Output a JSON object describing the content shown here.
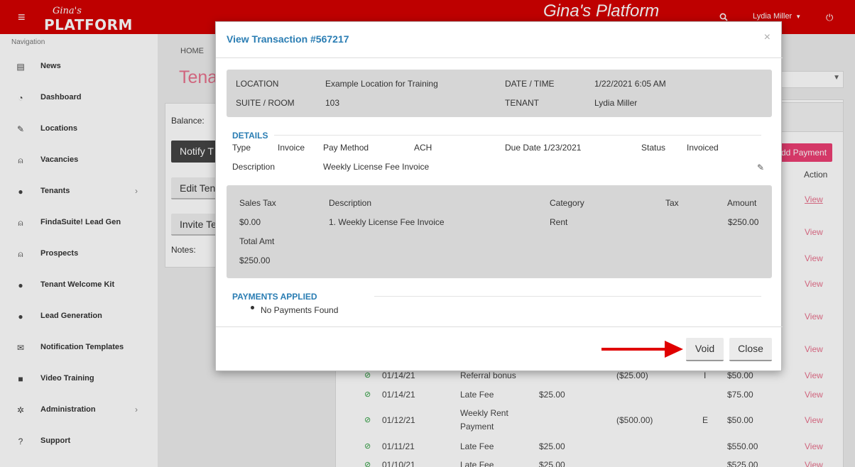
{
  "header": {
    "logo_script": "Gina's",
    "logo_main": "PLATFORM",
    "platform_name": "Gina's Platform",
    "user_name": "Lydia Miller"
  },
  "sidebar": {
    "heading": "Navigation",
    "items": [
      {
        "label": "News",
        "icon": "newspaper-icon",
        "glyph": "▤"
      },
      {
        "label": "Dashboard",
        "icon": "dashboard-icon",
        "glyph": "◔"
      },
      {
        "label": "Locations",
        "icon": "pin-icon",
        "glyph": "✎"
      },
      {
        "label": "Vacancies",
        "icon": "lock-icon",
        "glyph": "⍝"
      },
      {
        "label": "Tenants",
        "icon": "user-icon",
        "glyph": "●"
      },
      {
        "label": "FindaSuite! Lead Gen",
        "icon": "lock-icon",
        "glyph": "⍝"
      },
      {
        "label": "Prospects",
        "icon": "lock-icon",
        "glyph": "⍝"
      },
      {
        "label": "Tenant Welcome Kit",
        "icon": "user-icon",
        "glyph": "●"
      },
      {
        "label": "Lead Generation",
        "icon": "user-icon",
        "glyph": "●"
      },
      {
        "label": "Notification Templates",
        "icon": "envelope-icon",
        "glyph": "✉"
      },
      {
        "label": "Video Training",
        "icon": "video-icon",
        "glyph": "■"
      },
      {
        "label": "Administration",
        "icon": "gear-icon",
        "glyph": "✲"
      },
      {
        "label": "Support",
        "icon": "question-icon",
        "glyph": "?"
      }
    ]
  },
  "page": {
    "breadcrumb": "HOME",
    "title": "Tena",
    "balance_label": "Balance:",
    "notify_button": "Notify T",
    "edit_button": "Edit Ten",
    "invite_button": "Invite Te",
    "notes_label": "Notes:",
    "add_payment_button": "Add Payment",
    "action_header": "Action",
    "view_link": "View",
    "visible_rows": [
      {
        "date": "01/14/21",
        "description": "Referral bonus",
        "charge": "",
        "credit": "($25.00)",
        "code": "I",
        "balance": "$50.00"
      },
      {
        "date": "01/14/21",
        "description": "Late Fee",
        "charge": "$25.00",
        "credit": "",
        "code": "",
        "balance": "$75.00"
      },
      {
        "date": "01/12/21",
        "description": "Weekly Rent",
        "description2": "Payment",
        "charge": "",
        "credit": "($500.00)",
        "code": "E",
        "balance": "$50.00"
      },
      {
        "date": "01/11/21",
        "description": "Late Fee",
        "charge": "$25.00",
        "credit": "",
        "code": "",
        "balance": "$550.00"
      },
      {
        "date": "01/10/21",
        "description": "Late Fee",
        "charge": "$25.00",
        "credit": "",
        "code": "",
        "balance": "$525.00"
      }
    ]
  },
  "modal": {
    "title": "View Transaction #567217",
    "close_symbol": "×",
    "info": {
      "location_label": "LOCATION",
      "location_value": "Example Location for Training",
      "datetime_label": "DATE / TIME",
      "datetime_value": "1/22/2021 6:05 AM",
      "suite_label": "SUITE / ROOM",
      "suite_value": "103",
      "tenant_label": "TENANT",
      "tenant_value": "Lydia Miller"
    },
    "details": {
      "section_title": "DETAILS",
      "type_label": "Type",
      "type_value": "Invoice",
      "pay_method_label": "Pay Method",
      "pay_method_value": "ACH",
      "due_date": "Due Date 1/23/2021",
      "status_label": "Status",
      "status_value": "Invoiced",
      "description_label": "Description",
      "description_value": "Weekly License Fee Invoice"
    },
    "items": {
      "sales_tax_label": "Sales Tax",
      "sales_tax_value": "$0.00",
      "total_label": "Total Amt",
      "total_value": "$250.00",
      "col_description": "Description",
      "col_category": "Category",
      "col_tax": "Tax",
      "col_amount": "Amount",
      "line_description": "1.  Weekly License Fee Invoice",
      "line_category": "Rent",
      "line_amount": "$250.00"
    },
    "payments": {
      "section_title": "PAYMENTS APPLIED",
      "empty_text": "No Payments Found"
    },
    "void_button": "Void",
    "close_button": "Close"
  }
}
